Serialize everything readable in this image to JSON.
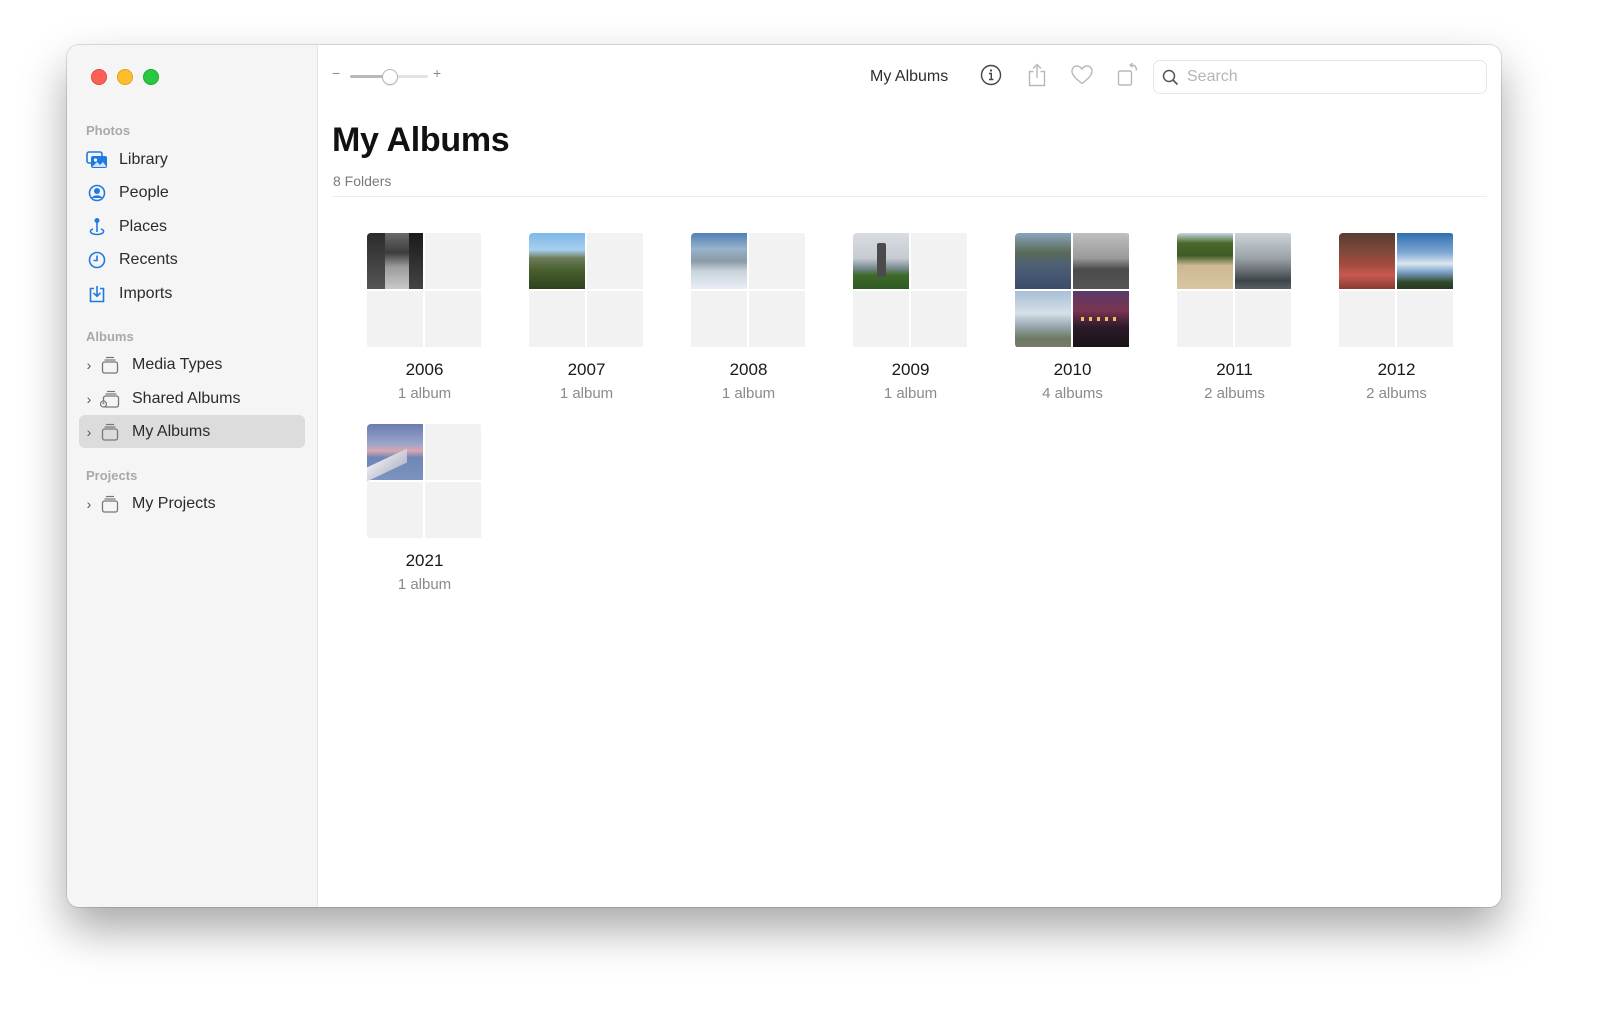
{
  "window": {
    "traffic_lights": [
      "close",
      "minimize",
      "zoom"
    ]
  },
  "sidebar": {
    "sections": [
      {
        "label": "Photos",
        "items": [
          {
            "label": "Library",
            "icon": "library-icon"
          },
          {
            "label": "People",
            "icon": "people-icon"
          },
          {
            "label": "Places",
            "icon": "places-icon"
          },
          {
            "label": "Recents",
            "icon": "recents-icon"
          },
          {
            "label": "Imports",
            "icon": "imports-icon"
          }
        ]
      },
      {
        "label": "Albums",
        "items": [
          {
            "label": "Media Types",
            "icon": "album-stack-icon",
            "expandable": true
          },
          {
            "label": "Shared Albums",
            "icon": "shared-album-icon",
            "expandable": true
          },
          {
            "label": "My Albums",
            "icon": "album-stack-icon",
            "expandable": true,
            "selected": true
          }
        ]
      },
      {
        "label": "Projects",
        "items": [
          {
            "label": "My Projects",
            "icon": "album-stack-icon",
            "expandable": true
          }
        ]
      }
    ]
  },
  "toolbar": {
    "zoom_minus": "−",
    "zoom_plus": "+",
    "zoom_level": 0.5,
    "title": "My Albums",
    "icons": [
      "info-icon",
      "share-icon",
      "favorite-icon",
      "rotate-icon"
    ],
    "search": {
      "placeholder": "Search",
      "value": ""
    }
  },
  "page": {
    "title": "My Albums",
    "subtitle": "8 Folders"
  },
  "folders": [
    {
      "name": "2006",
      "count": "1 album",
      "photos": [
        "street"
      ]
    },
    {
      "name": "2007",
      "count": "1 album",
      "photos": [
        "mountain"
      ]
    },
    {
      "name": "2008",
      "count": "1 album",
      "photos": [
        "snow"
      ]
    },
    {
      "name": "2009",
      "count": "1 album",
      "photos": [
        "statue"
      ]
    },
    {
      "name": "2010",
      "count": "4 albums",
      "photos": [
        "canal",
        "gray-harbor",
        "beach-sky",
        "night"
      ]
    },
    {
      "name": "2011",
      "count": "2 albums",
      "photos": [
        "park",
        "boats"
      ]
    },
    {
      "name": "2012",
      "count": "2 albums",
      "photos": [
        "living",
        "bird"
      ]
    },
    {
      "name": "2021",
      "count": "1 album",
      "photos": [
        "wing"
      ]
    }
  ],
  "colors": {
    "accent": "#1f7ae0",
    "sidebar_bg": "#f5f5f5",
    "selected_bg": "#dcdcdc"
  }
}
